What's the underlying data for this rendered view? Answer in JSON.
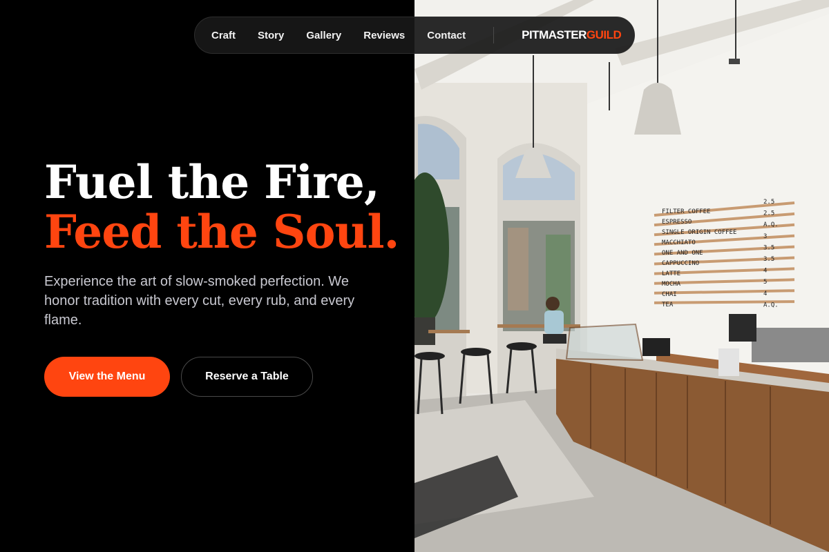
{
  "colors": {
    "accent": "#ff4510",
    "background": "#000000",
    "text": "#ffffff",
    "muted_text": "#c9c9d1"
  },
  "nav": {
    "items": [
      "Craft",
      "Story",
      "Gallery",
      "Reviews",
      "Contact"
    ],
    "brand_primary": "PITMASTER",
    "brand_accent": "GUILD"
  },
  "hero": {
    "headline_line1": "Fuel the Fire,",
    "headline_line2": "Feed the Soul.",
    "subtext": "Experience the art of slow-smoked perfection. We honor tradition with every cut, every rub, and every flame.",
    "primary_button": "View the Menu",
    "secondary_button": "Reserve a Table"
  },
  "menu_board": {
    "items": [
      {
        "name": "FILTER COFFEE",
        "price": "2.5"
      },
      {
        "name": "ESPRESSO",
        "price": "2.5"
      },
      {
        "name": "SINGLE ORIGIN COFFEE",
        "price": "A.Q."
      },
      {
        "name": "MACCHIATO",
        "price": "3"
      },
      {
        "name": "ONE AND ONE",
        "price": "3.5"
      },
      {
        "name": "CAPPUCCINO",
        "price": "3.5"
      },
      {
        "name": "LATTE",
        "price": "4"
      },
      {
        "name": "MOCHA",
        "price": "5"
      },
      {
        "name": "CHAI",
        "price": "4"
      },
      {
        "name": "TEA",
        "price": "A.Q."
      }
    ]
  }
}
